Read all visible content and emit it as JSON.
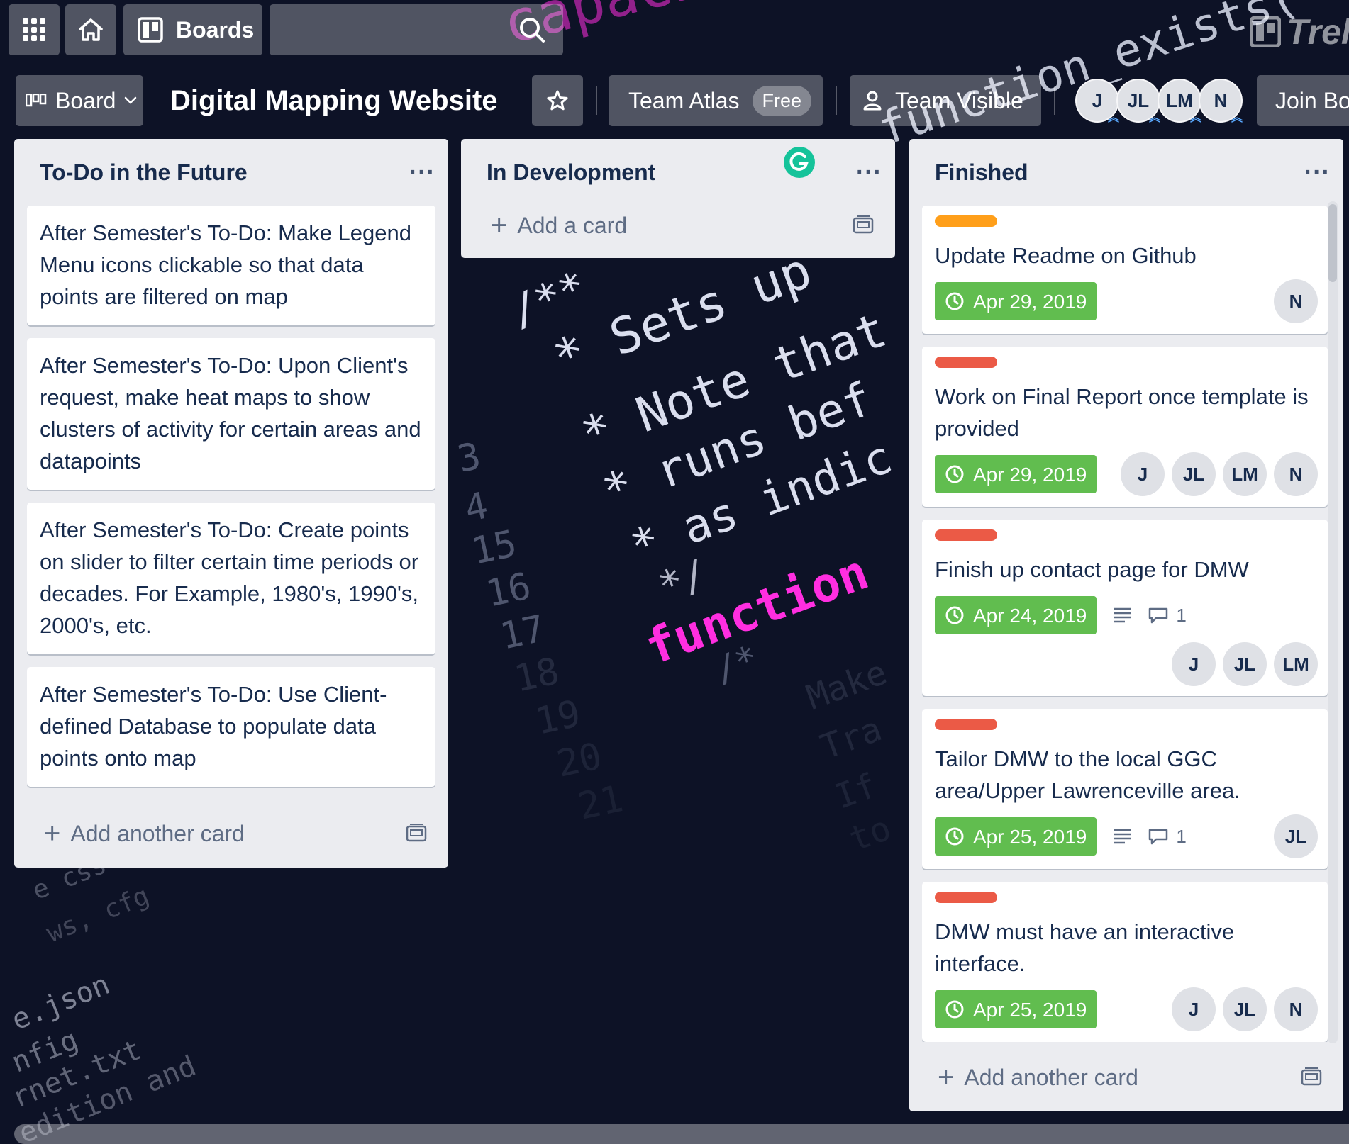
{
  "header": {
    "boards_label": "Boards",
    "search_value": "",
    "logo_text": "Trello"
  },
  "board": {
    "view_label": "Board",
    "title": "Digital Mapping Website",
    "team_name": "Team Atlas",
    "team_badge": "Free",
    "visibility": "Team Visible",
    "members": [
      "J",
      "JL",
      "LM",
      "N"
    ],
    "join_label": "Join Bo"
  },
  "lists": [
    {
      "title": "To-Do in the Future",
      "cards": [
        "After Semester's To-Do: Make Legend Menu icons clickable so that data points are filtered on map",
        "After Semester's To-Do: Upon Client's request, make heat maps to show clusters of activity for certain areas and datapoints",
        "After Semester's To-Do: Create points on slider to filter certain time periods or decades. For Example, 1980's, 1990's, 2000's, etc.",
        "After Semester's To-Do: Use Client-defined Database to populate data points onto map"
      ],
      "add_label": "Add another card"
    },
    {
      "title": "In Development",
      "cards": [],
      "add_label": "Add a card"
    },
    {
      "title": "Finished",
      "cards": [
        {
          "label_color": "#ff9f1a",
          "title": "Update Readme on Github",
          "due": "Apr 29, 2019",
          "members": [
            "N"
          ]
        },
        {
          "label_color": "#eb5a46",
          "title": "Work on Final Report once template is provided",
          "due": "Apr 29, 2019",
          "members": [
            "J",
            "JL",
            "LM",
            "N"
          ]
        },
        {
          "label_color": "#eb5a46",
          "title": "Finish up contact page for DMW",
          "due": "Apr 24, 2019",
          "comments": "1",
          "members": [
            "J",
            "JL",
            "LM"
          ]
        },
        {
          "label_color": "#eb5a46",
          "title": "Tailor DMW to the local GGC area/Upper Lawrenceville area.",
          "due": "Apr 25, 2019",
          "comments": "1",
          "members": [
            "JL"
          ]
        },
        {
          "label_color": "#eb5a46",
          "title": "DMW must have an interactive interface.",
          "due": "Apr 25, 2019",
          "members": [
            "J",
            "JL",
            "N"
          ]
        },
        {
          "label_color": "#f2d600",
          "title": "",
          "due": "",
          "members": []
        }
      ],
      "add_label": "Add another card"
    }
  ],
  "background": {
    "lines": [
      "capacity",
      "function_exists(",
      "/**",
      "* Sets up",
      "* Note that",
      "* runs bef",
      "* as indic",
      "*/",
      "function",
      "/*",
      "3",
      "4",
      "15",
      "16",
      "17",
      "18",
      "19",
      "20",
      "21",
      "Make",
      "Tra",
      "If",
      "to",
      "e.json",
      "nfig",
      "rnet.txt",
      "edition and",
      "e css",
      "ws, cfg"
    ]
  }
}
